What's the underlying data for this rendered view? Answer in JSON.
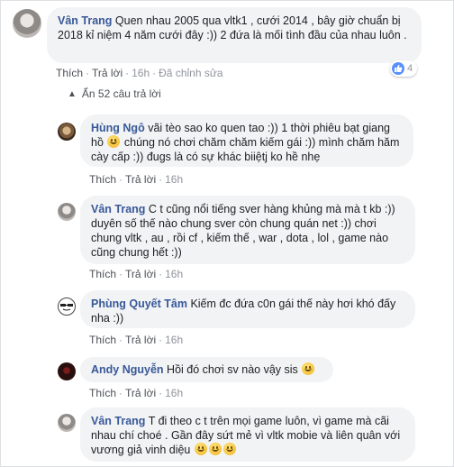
{
  "comments": [
    {
      "name": "Vân Trang",
      "text": "Quen nhau 2005 qua vltk1 , cưới 2014 , bây giờ chuẩn bị 2018 kỉ niệm 4 năm cưới đây :)) 2 đứa là mối tình đầu của nhau luôn .",
      "like": "Thích",
      "reply": "Trả lời",
      "time": "16h",
      "edited": "Đã chỉnh sửa",
      "reaction_count": "4"
    }
  ],
  "hidden_replies": "Ẩn 52 câu trả lời",
  "replies": [
    {
      "name": "Hùng Ngô",
      "text_a": "vãi tèo sao ko quen tao :)) 1 thời phiêu bạt giang hồ",
      "text_b": "chúng nó chơi chăm chăm kiếm gái :)) mình chăm hăm cày cấp :)) đugs là có sự khác biiệtj ko hề nhẹ",
      "like": "Thích",
      "reply": "Trả lời",
      "time": "16h"
    },
    {
      "name": "Vân Trang",
      "text": "C t cũng nổi tiếng sver hàng khủng mà mà t kb :)) duyên số thế nào chung sver còn chung quán net :)) chơi chung vltk , au , rồi cf , kiếm thế , war , dota , lol , game nào cũng chung hết :))",
      "like": "Thích",
      "reply": "Trả lời",
      "time": "16h"
    },
    {
      "name": "Phùng Quyết Tâm",
      "text": "Kiếm đc đứa c0n gái thế này hơi khó đấy nha :))",
      "like": "Thích",
      "reply": "Trả lời",
      "time": "16h"
    },
    {
      "name": "Andy Nguyễn",
      "text": "Hồi đó chơi sv nào vậy sis",
      "like": "Thích",
      "reply": "Trả lời",
      "time": "16h"
    },
    {
      "name": "Vân Trang",
      "text": "T đi theo c t trên mọi game luôn, vì game mà cãi nhau chí choé . Gần đây sứt mẻ vì vltk mobie và liên quân với vương giả vinh diệu",
      "like": "Thích",
      "reply": "Trả lời",
      "time": "16h"
    }
  ]
}
